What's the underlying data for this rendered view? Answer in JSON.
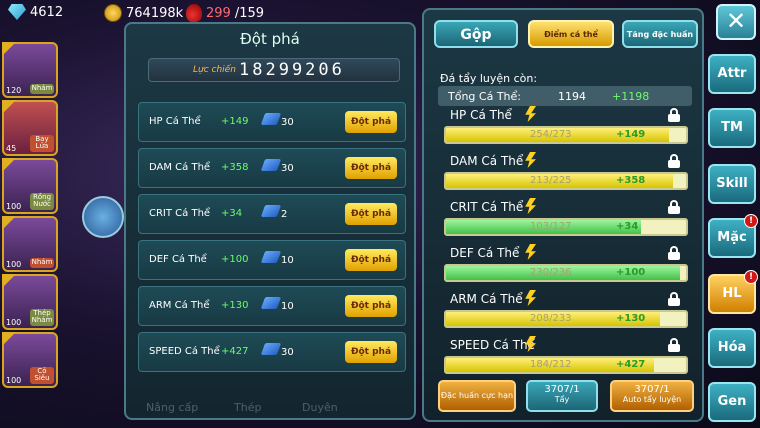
{
  "topbar": {
    "gems": "4612",
    "gold": "764198k",
    "stamina_current": "299",
    "stamina_max": "/159"
  },
  "party": [
    {
      "level": "120",
      "type": "Nhám",
      "active": false
    },
    {
      "level": "45",
      "type": "Bay\nLửa",
      "active": true
    },
    {
      "level": "100",
      "type": "Rồng\nNước",
      "active": false
    },
    {
      "level": "100",
      "type": "Nhám",
      "active": false
    },
    {
      "level": "100",
      "type": "Thép\nNhám",
      "active": false
    },
    {
      "level": "100",
      "type": "Cỏ\nSiêu",
      "active": false
    }
  ],
  "breakthrough": {
    "title": "Đột phá",
    "power_label": "Lực chiến",
    "power_value": "18299206",
    "button_label": "Đột phá",
    "rows": [
      {
        "name": "HP Cá Thể",
        "add": "+149",
        "count": "30"
      },
      {
        "name": "DAM Cá Thể",
        "add": "+358",
        "count": "30"
      },
      {
        "name": "CRIT Cá Thể",
        "add": "+34",
        "count": "2"
      },
      {
        "name": "DEF Cá Thể",
        "add": "+100",
        "count": "10"
      },
      {
        "name": "ARM Cá Thể",
        "add": "+130",
        "count": "10"
      },
      {
        "name": "SPEED Cá Thể",
        "add": "+427",
        "count": "30"
      }
    ],
    "ghost_tabs": [
      "Nâng cấp",
      "Thép",
      "Duyên"
    ]
  },
  "stats_panel": {
    "tabs": {
      "gop": "Gộp",
      "diem_ca_the": "Điểm cá thể",
      "tang_dac_huan": "Tăng đặc huấn"
    },
    "subtitle": "Đá tẩy luyện còn:",
    "total_label": "Tổng Cá Thể:",
    "total_value": "1194",
    "total_add": "+1198",
    "stats": [
      {
        "name": "HP Cá Thể",
        "current": 254,
        "max": 273,
        "label": "254/273",
        "add": "+149"
      },
      {
        "name": "DAM Cá Thể",
        "current": 213,
        "max": 225,
        "label": "213/225",
        "add": "+358"
      },
      {
        "name": "CRIT Cá Thể",
        "current": 103,
        "max": 127,
        "label": "103/127",
        "add": "+34",
        "green": true
      },
      {
        "name": "DEF Cá Thể",
        "current": 230,
        "max": 236,
        "label": "230/236",
        "add": "+100",
        "green": true
      },
      {
        "name": "ARM Cá Thể",
        "current": 208,
        "max": 233,
        "label": "208/233",
        "add": "+130"
      },
      {
        "name": "SPEED Cá Thể",
        "current": 184,
        "max": 212,
        "label": "184/212",
        "add": "+427"
      }
    ],
    "bottom": {
      "dac_huan": "Đặc huấn cực hạn",
      "tay_count": "3707/1",
      "tay_label": "Tẩy",
      "auto_count": "3707/1",
      "auto_label": "Auto tẩy luyện"
    }
  },
  "side_buttons": [
    {
      "label": "Attr",
      "badge": false
    },
    {
      "label": "TM",
      "badge": false
    },
    {
      "label": "Skill",
      "badge": false
    },
    {
      "label": "Mặc",
      "badge": true
    },
    {
      "label": "HL",
      "badge": true,
      "active": true
    },
    {
      "label": "Hóa",
      "badge": false
    },
    {
      "label": "Gen",
      "badge": false
    }
  ],
  "close_label": "✕"
}
